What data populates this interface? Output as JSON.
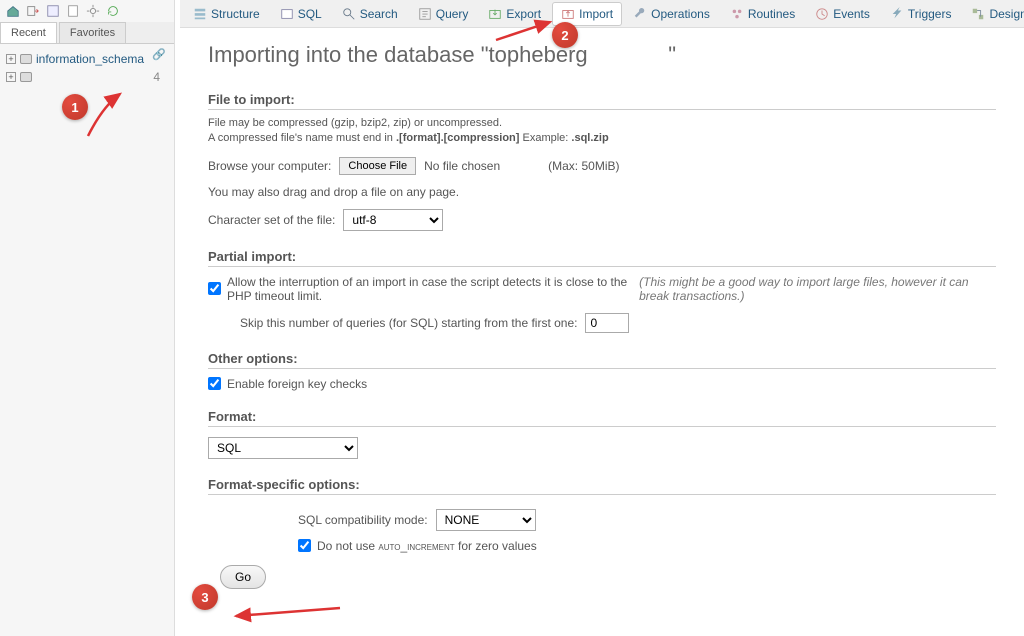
{
  "sidebar": {
    "tabs": {
      "recent": "Recent",
      "favorites": "Favorites"
    },
    "items": [
      {
        "label": "information_schema",
        "count": ""
      },
      {
        "label": "",
        "count": "4"
      }
    ]
  },
  "topnav": [
    {
      "key": "structure",
      "label": "Structure"
    },
    {
      "key": "sql",
      "label": "SQL"
    },
    {
      "key": "search",
      "label": "Search"
    },
    {
      "key": "query",
      "label": "Query"
    },
    {
      "key": "export",
      "label": "Export"
    },
    {
      "key": "import",
      "label": "Import",
      "active": true
    },
    {
      "key": "operations",
      "label": "Operations"
    },
    {
      "key": "routines",
      "label": "Routines"
    },
    {
      "key": "events",
      "label": "Events"
    },
    {
      "key": "triggers",
      "label": "Triggers"
    },
    {
      "key": "designer",
      "label": "Designer"
    }
  ],
  "title_prefix": "Importing into the database \"",
  "title_db": "topheberg",
  "title_suffix": "\"",
  "file": {
    "heading": "File to import:",
    "line1": "File may be compressed (gzip, bzip2, zip) or uncompressed.",
    "line2a": "A compressed file's name must end in ",
    "line2b": ".[format].[compression]",
    "line2c": " Example: ",
    "line2d": ".sql.zip",
    "browse_label": "Browse your computer:",
    "choose_btn": "Choose File",
    "no_file": "No file chosen",
    "max": "(Max: 50MiB)",
    "dragdrop": "You may also drag and drop a file on any page.",
    "charset_label": "Character set of the file:",
    "charset_value": "utf-8"
  },
  "partial": {
    "heading": "Partial import:",
    "allow_label": "Allow the interruption of an import in case the script detects it is close to the PHP timeout limit.",
    "allow_note": "(This might be a good way to import large files, however it can break transactions.)",
    "skip_label": "Skip this number of queries (for SQL) starting from the first one:",
    "skip_value": "0"
  },
  "other": {
    "heading": "Other options:",
    "fk_label": "Enable foreign key checks"
  },
  "format": {
    "heading": "Format:",
    "value": "SQL"
  },
  "fso": {
    "heading": "Format-specific options:",
    "compat_label": "SQL compatibility mode:",
    "compat_value": "NONE",
    "auto_prefix": "Do not use ",
    "auto_word": "auto_increment",
    "auto_suffix": " for zero values"
  },
  "go_label": "Go",
  "badges": {
    "b1": "1",
    "b2": "2",
    "b3": "3"
  }
}
